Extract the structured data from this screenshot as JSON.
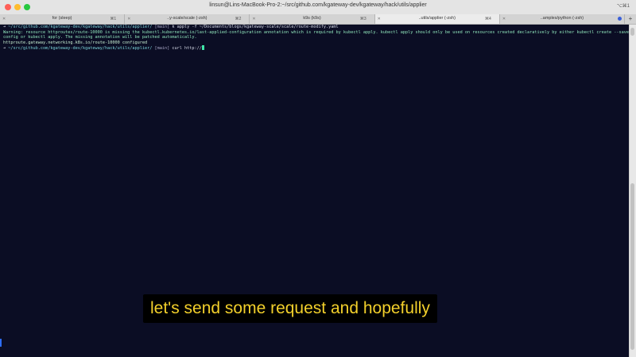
{
  "window": {
    "title": "linsun@Lins-MacBook-Pro-2:~/src/github.com/kgateway-dev/kgateway/hack/utils/applier",
    "title_shortcut": "⌥⌘1"
  },
  "tabs": [
    {
      "title": "for (sleep)",
      "shortcut": "⌘1",
      "close": "✕"
    },
    {
      "title": "..y-scale/scale (-zsh)",
      "shortcut": "⌘2",
      "close": "✕"
    },
    {
      "title": "k9s (k9s)",
      "shortcut": "⌘3",
      "close": "✕"
    },
    {
      "title": "..utils/applier (-zsh)",
      "shortcut": "⌘4",
      "close": "✕"
    },
    {
      "title": "..amples/python (-zsh)",
      "shortcut": "",
      "close": "✕"
    }
  ],
  "new_tab_label": "+",
  "terminal": {
    "line1": {
      "arrow": "➜",
      "path": "~/src/github.com/kgateway-dev/kgateway/hack/utils/applier/",
      "branch": "[main]",
      "command": "k apply -f ~/Documents/blogs/kgateway-scale/scale/route-modify.yaml"
    },
    "warning": "Warning: resource httproutes/route-10000 is missing the kubectl.kubernetes.io/last-applied-configuration annotation which is required by kubectl apply. kubectl apply should only be used on resources created declaratively by either kubectl create --save-config or kubectl apply. The missing annotation will be patched automatically.",
    "result": "httproute.gateway.networking.k8s.io/route-10000 configured",
    "line2": {
      "arrow": "➜",
      "path": "~/src/github.com/kgateway-dev/kgateway/hack/utils/applier/",
      "branch": "[main]",
      "command": "curl http://"
    }
  },
  "caption": "let's send some request and hopefully",
  "colors": {
    "terminal_bg": "#0b0d24",
    "prompt_path": "#7ad3d8",
    "warning_text": "#8fe3ba",
    "cursor": "#3ee6a8",
    "caption_text": "#f3d02b"
  }
}
